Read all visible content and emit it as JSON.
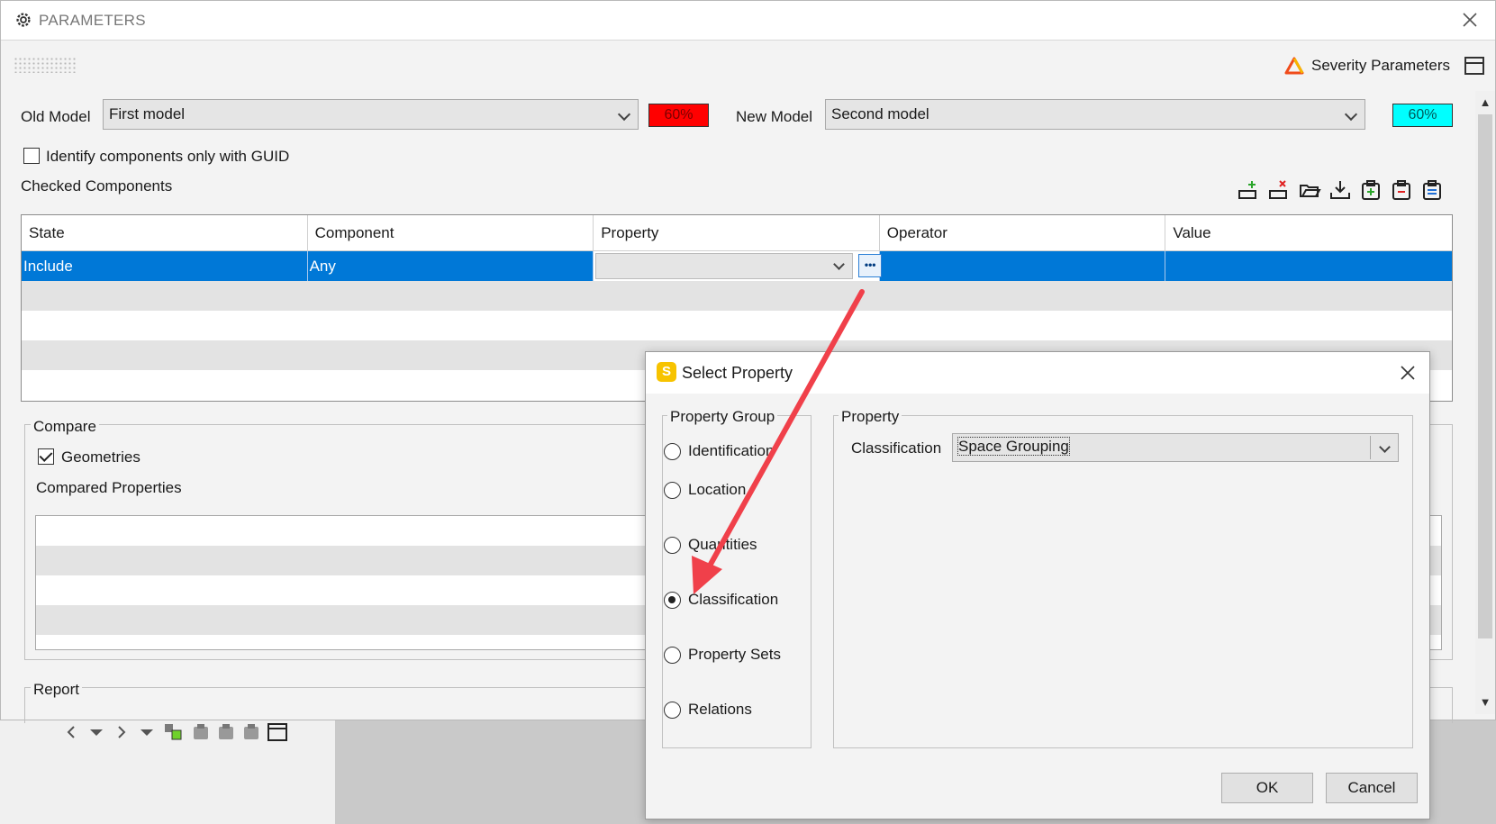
{
  "window": {
    "title": "PARAMETERS"
  },
  "header": {
    "severity_label": "Severity Parameters"
  },
  "old_model": {
    "label": "Old Model",
    "value": "First model",
    "percent": "60%",
    "color": "#ff0000"
  },
  "new_model": {
    "label": "New Model",
    "value": "Second model",
    "percent": "60%",
    "color": "#00ffff"
  },
  "options": {
    "guid_only_label": "Identify components only with GUID",
    "guid_only_checked": false
  },
  "checked_components": {
    "title": "Checked Components",
    "columns": [
      "State",
      "Component",
      "Property",
      "Operator",
      "Value"
    ],
    "rows": [
      {
        "state": "Include",
        "component": "Any",
        "property": "",
        "operator": "",
        "value": ""
      }
    ]
  },
  "compare": {
    "title": "Compare",
    "geometries_label": "Geometries",
    "geometries_checked": true,
    "compared_properties_label": "Compared Properties"
  },
  "report": {
    "title": "Report"
  },
  "dialog": {
    "title": "Select Property",
    "logo_letter": "S",
    "property_group_title": "Property Group",
    "groups": [
      {
        "label": "Identification",
        "selected": false
      },
      {
        "label": "Location",
        "selected": false
      },
      {
        "label": "Quantities",
        "selected": false
      },
      {
        "label": "Classification",
        "selected": true
      },
      {
        "label": "Property Sets",
        "selected": false
      },
      {
        "label": "Relations",
        "selected": false
      }
    ],
    "property_title": "Property",
    "classification_label": "Classification",
    "classification_value": "Space Grouping",
    "ok_label": "OK",
    "cancel_label": "Cancel"
  },
  "colors": {
    "selection": "#0078d7",
    "arrow": "#f0404a",
    "accent_logo": "#f7c300"
  }
}
